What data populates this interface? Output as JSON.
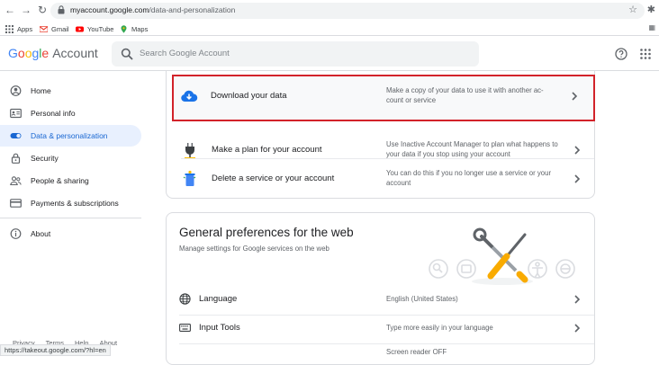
{
  "browser": {
    "url_host": "myaccount.google.com",
    "url_path": "/data-and-personalization",
    "bookmarks": [
      {
        "label": "Apps",
        "icon": "apps-grid-icon",
        "color": "#5f6368"
      },
      {
        "label": "Gmail",
        "icon": "gmail-icon",
        "color": "#ea4335"
      },
      {
        "label": "YouTube",
        "icon": "youtube-icon",
        "color": "#ff0000"
      },
      {
        "label": "Maps",
        "icon": "maps-pin-icon",
        "color": "#34a853"
      }
    ],
    "status_url": "https://takeout.google.com/?hl=en"
  },
  "header": {
    "logo_google": [
      "G",
      "o",
      "o",
      "g",
      "l",
      "e"
    ],
    "logo_account": "Account",
    "search_placeholder": "Search Google Account"
  },
  "sidebar": {
    "items": [
      {
        "label": "Home",
        "icon": "account-circle-icon",
        "active": false
      },
      {
        "label": "Personal info",
        "icon": "id-card-icon",
        "active": false
      },
      {
        "label": "Data & personalization",
        "icon": "toggle-icon",
        "active": true
      },
      {
        "label": "Security",
        "icon": "lock-icon",
        "active": false
      },
      {
        "label": "People & sharing",
        "icon": "people-icon",
        "active": false
      },
      {
        "label": "Payments & subscriptions",
        "icon": "credit-card-icon",
        "active": false
      }
    ],
    "about_label": "About",
    "footer_links": [
      "Privacy",
      "Terms",
      "Help",
      "About"
    ]
  },
  "data_card": {
    "rows": [
      {
        "title": "Download your data",
        "desc": "Make a copy of your data to use it with another ac-count or service",
        "icon": "cloud-download-icon"
      },
      {
        "title": "Make a plan for your account",
        "desc": "Use Inactive Account Manager to plan what happens to your data if you stop using your account",
        "icon": "plug-icon"
      },
      {
        "title": "Delete a service or your account",
        "desc": "You can do this if you no longer use a service or your account",
        "icon": "trash-can-icon"
      }
    ]
  },
  "preferences_card": {
    "title": "General preferences for the web",
    "subtitle": "Manage settings for Google services on the web",
    "rows": [
      {
        "label": "Language",
        "value": "English (United States)",
        "icon": "globe-icon"
      },
      {
        "label": "Input Tools",
        "value": "Type more easily in your language",
        "icon": "keyboard-icon"
      }
    ],
    "partial_value": "Screen reader OFF"
  },
  "colors": {
    "accent": "#1a73e8",
    "active_bg": "#e8f0fe",
    "highlight_border": "#d2232a",
    "divider": "#dadce0"
  }
}
